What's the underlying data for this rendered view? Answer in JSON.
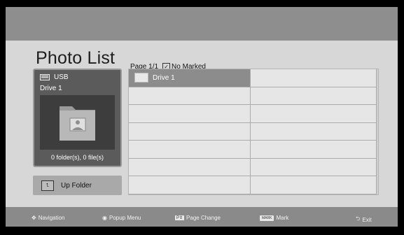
{
  "window": {
    "title": "Photo List"
  },
  "page_info": {
    "page": "Page 1/1",
    "marked": "No Marked",
    "checkbox_glyph": "✓"
  },
  "preview": {
    "device": "USB",
    "drive": "Drive 1",
    "summary": "0 folder(s), 0 file(s)"
  },
  "up_folder": {
    "label": "Up Folder"
  },
  "grid": {
    "items": [
      {
        "label": "Drive 1"
      },
      {
        "label": ""
      },
      {
        "label": ""
      },
      {
        "label": ""
      },
      {
        "label": ""
      },
      {
        "label": ""
      },
      {
        "label": ""
      },
      {
        "label": ""
      },
      {
        "label": ""
      },
      {
        "label": ""
      },
      {
        "label": ""
      },
      {
        "label": ""
      },
      {
        "label": ""
      },
      {
        "label": ""
      }
    ]
  },
  "footer": {
    "navigation": "Navigation",
    "popup_menu": "Popup Menu",
    "page_change": "Page Change",
    "mark_badge": "MARK",
    "mark": "Mark",
    "exit": "Exit"
  },
  "icons": [
    "usb-icon",
    "folder-icon",
    "photo-icon",
    "up-folder-icon",
    "navigation-icon",
    "ok-icon",
    "page-icon",
    "mark-icon",
    "exit-icon"
  ],
  "colors": {
    "background": "#d7d7d7",
    "selection": "#8c8c8c",
    "bars": "#8e8e8e"
  }
}
